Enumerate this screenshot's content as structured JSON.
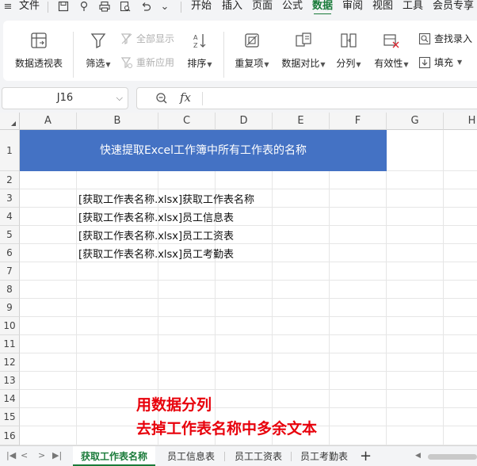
{
  "menu": {
    "file": "文件",
    "tabs": [
      {
        "label": "开始",
        "active": false
      },
      {
        "label": "插入",
        "active": false
      },
      {
        "label": "页面",
        "active": false
      },
      {
        "label": "公式",
        "active": false
      },
      {
        "label": "数据",
        "active": true
      },
      {
        "label": "审阅",
        "active": false
      },
      {
        "label": "视图",
        "active": false
      },
      {
        "label": "工具",
        "active": false
      },
      {
        "label": "会员专享",
        "active": false
      }
    ]
  },
  "ribbon": {
    "pivot": "数据透视表",
    "filter": "筛选",
    "show_all": "全部显示",
    "reapply": "重新应用",
    "sort": "排序",
    "duplicates": "重复项",
    "compare": "数据对比",
    "split": "分列",
    "validity": "有效性",
    "lookup_entry": "查找录入",
    "fill": "填充"
  },
  "formula_bar": {
    "name_box": "J16",
    "fx": "fx",
    "value": ""
  },
  "grid": {
    "columns": [
      "A",
      "B",
      "C",
      "D",
      "E",
      "F",
      "G",
      "H"
    ],
    "rows": [
      "1",
      "2",
      "3",
      "4",
      "5",
      "6",
      "7",
      "8",
      "9",
      "10",
      "11",
      "12",
      "13",
      "14",
      "15",
      "16"
    ],
    "title": "快速提取Excel工作簿中所有工作表的名称",
    "cells": [
      "[获取工作表名称.xlsx]获取工作表名称",
      "[获取工作表名称.xlsx]员工信息表",
      "[获取工作表名称.xlsx]员工工资表",
      "[获取工作表名称.xlsx]员工考勤表"
    ],
    "note_line1": "用数据分列",
    "note_line2": "去掉工作表名称中多余文本"
  },
  "sheets": [
    {
      "label": "获取工作表名称",
      "active": true
    },
    {
      "label": "员工信息表",
      "active": false
    },
    {
      "label": "员工工资表",
      "active": false
    },
    {
      "label": "员工考勤表",
      "active": false
    }
  ],
  "add_sheet": "+",
  "colors": {
    "accent_green": "#1a7b3a",
    "title_fill": "#4472c4",
    "note_red": "#e8000b"
  }
}
